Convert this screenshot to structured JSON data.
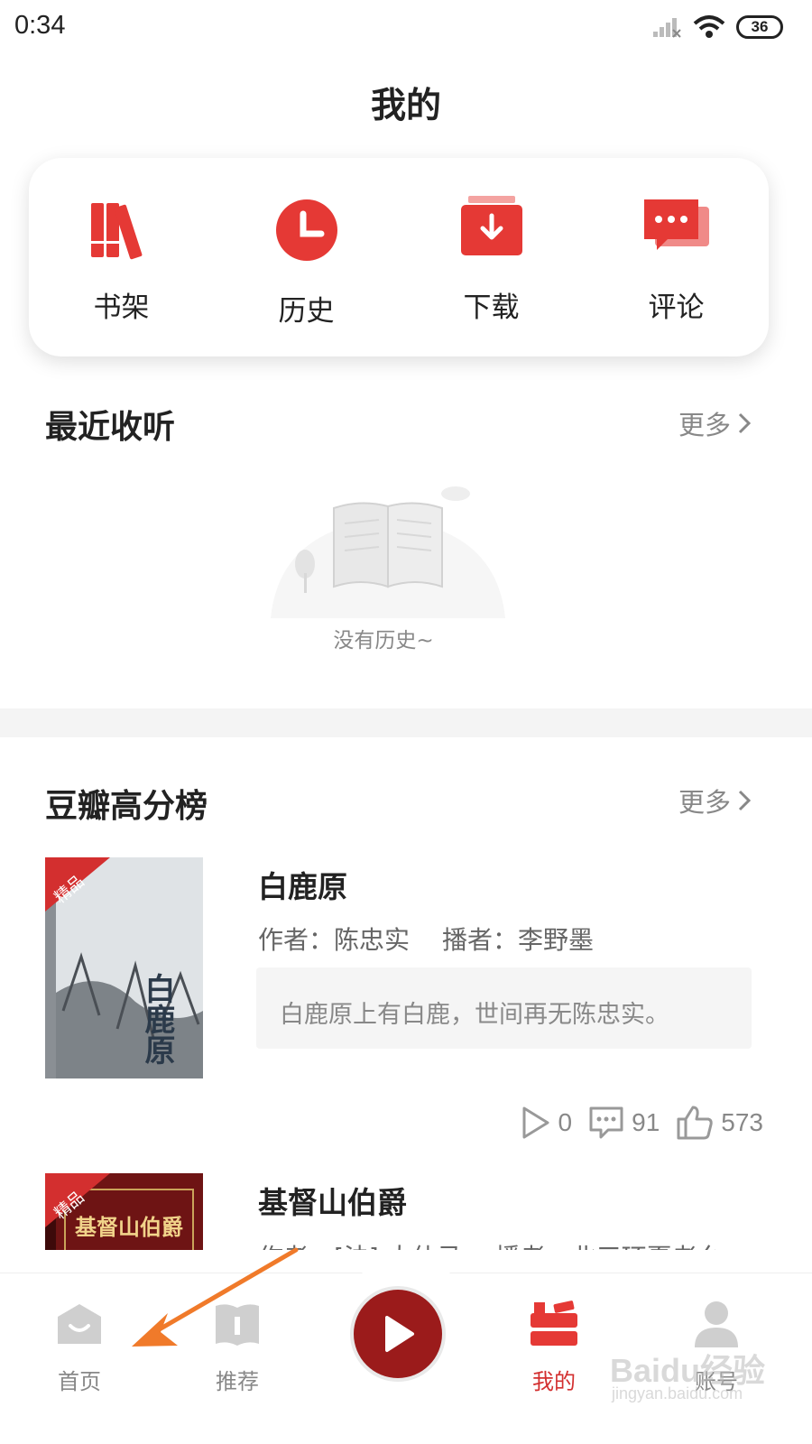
{
  "status": {
    "time": "0:34",
    "battery": "36"
  },
  "header": {
    "title": "我的"
  },
  "quick": [
    {
      "label": "书架",
      "icon": "bookshelf-icon"
    },
    {
      "label": "历史",
      "icon": "clock-icon"
    },
    {
      "label": "下载",
      "icon": "download-icon"
    },
    {
      "label": "评论",
      "icon": "comment-icon"
    }
  ],
  "recent": {
    "title": "最近收听",
    "more": "更多",
    "empty_text": "没有历史~"
  },
  "douban": {
    "title": "豆瓣高分榜",
    "more": "更多",
    "books": [
      {
        "badge": "精品",
        "cover_title": "白鹿原",
        "title": "白鹿原",
        "author": "作者：陈忠实",
        "narrator": "播者：李野墨",
        "quote": "白鹿原上有白鹿，世间再无陈忠实。",
        "plays": "0",
        "comments": "91",
        "likes": "573"
      },
      {
        "badge": "精品",
        "cover_title": "基督山伯爵",
        "title": "基督山伯爵",
        "author": "作者：[法] 大仲马",
        "narrator": "播者：北三环夏老幺"
      }
    ]
  },
  "nav": [
    {
      "label": "首页",
      "icon": "home-icon"
    },
    {
      "label": "推荐",
      "icon": "recommend-icon"
    },
    {
      "label": "我的",
      "icon": "mine-icon",
      "active": true
    },
    {
      "label": "账号",
      "icon": "account-icon"
    }
  ],
  "watermark": {
    "brand": "Baidu经验",
    "url": "jingyan.baidu.com"
  },
  "colors": {
    "accent": "#e53935",
    "player": "#9b1b1b",
    "arrow": "#f07a2a"
  }
}
